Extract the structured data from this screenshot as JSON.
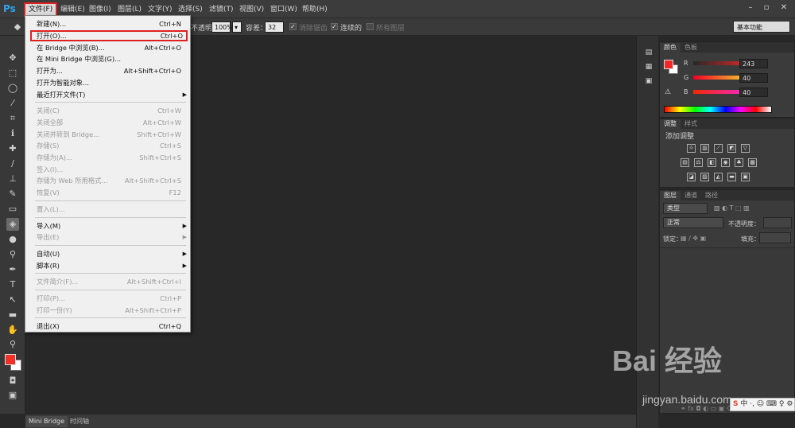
{
  "app": {
    "logo": "Ps"
  },
  "menubar": {
    "items": [
      "文件(F)",
      "编辑(E)",
      "图像(I)",
      "图层(L)",
      "文字(Y)",
      "选择(S)",
      "滤镜(T)",
      "视图(V)",
      "窗口(W)",
      "帮助(H)"
    ]
  },
  "options": {
    "opacity_label": "不透明度：",
    "opacity_value": "100%",
    "tolerance_label": "容差：",
    "tolerance_value": "32",
    "anti_alias_label": "消除锯齿",
    "contiguous_label": "连续的",
    "all_layers_label": "所有图层",
    "workspace": "基本功能"
  },
  "file_menu": {
    "items": [
      {
        "label": "新建(N)...",
        "shortcut": "Ctrl+N",
        "enabled": true
      },
      {
        "label": "打开(O)...",
        "shortcut": "Ctrl+O",
        "enabled": true,
        "highlighted": true
      },
      {
        "label": "在 Bridge 中浏览(B)...",
        "shortcut": "Alt+Ctrl+O",
        "enabled": true
      },
      {
        "label": "在 Mini Bridge 中浏览(G)...",
        "shortcut": "",
        "enabled": true
      },
      {
        "label": "打开为...",
        "shortcut": "Alt+Shift+Ctrl+O",
        "enabled": true
      },
      {
        "label": "打开为智能对象...",
        "shortcut": "",
        "enabled": true
      },
      {
        "label": "最近打开文件(T)",
        "shortcut": "",
        "enabled": true,
        "submenu": true
      },
      {
        "label": "关闭(C)",
        "shortcut": "Ctrl+W",
        "enabled": false
      },
      {
        "label": "关闭全部",
        "shortcut": "Alt+Ctrl+W",
        "enabled": false
      },
      {
        "label": "关闭并转到 Bridge...",
        "shortcut": "Shift+Ctrl+W",
        "enabled": false
      },
      {
        "label": "存储(S)",
        "shortcut": "Ctrl+S",
        "enabled": false
      },
      {
        "label": "存储为(A)...",
        "shortcut": "Shift+Ctrl+S",
        "enabled": false
      },
      {
        "label": "签入(I)...",
        "shortcut": "",
        "enabled": false
      },
      {
        "label": "存储为 Web 所用格式...",
        "shortcut": "Alt+Shift+Ctrl+S",
        "enabled": false
      },
      {
        "label": "恢复(V)",
        "shortcut": "F12",
        "enabled": false
      },
      {
        "label": "置入(L)...",
        "shortcut": "",
        "enabled": false
      },
      {
        "label": "导入(M)",
        "shortcut": "",
        "enabled": true,
        "submenu": true
      },
      {
        "label": "导出(E)",
        "shortcut": "",
        "enabled": false,
        "submenu": true
      },
      {
        "label": "自动(U)",
        "shortcut": "",
        "enabled": true,
        "submenu": true
      },
      {
        "label": "脚本(R)",
        "shortcut": "",
        "enabled": true,
        "submenu": true
      },
      {
        "label": "文件简介(F)...",
        "shortcut": "Alt+Shift+Ctrl+I",
        "enabled": false
      },
      {
        "label": "打印(P)...",
        "shortcut": "Ctrl+P",
        "enabled": false
      },
      {
        "label": "打印一份(Y)",
        "shortcut": "Alt+Shift+Ctrl+P",
        "enabled": false
      },
      {
        "label": "退出(X)",
        "shortcut": "Ctrl+Q",
        "enabled": true
      }
    ]
  },
  "color_panel": {
    "tabs": [
      "颜色",
      "色板"
    ],
    "r_label": "R",
    "r_value": "243",
    "g_label": "G",
    "g_value": "40",
    "b_label": "B",
    "b_value": "40",
    "foreground_color": "#f32828"
  },
  "adjust_panel": {
    "tabs": [
      "调整",
      "样式"
    ],
    "heading": "添加调整"
  },
  "layers_panel": {
    "tabs": [
      "图层",
      "通道",
      "路径"
    ],
    "filter_kind": "类型",
    "blend_mode": "正常",
    "opacity_label": "不透明度：",
    "lock_label": "锁定：",
    "fill_label": "填充："
  },
  "bottom": {
    "tabs": [
      "Mini Bridge",
      "时间轴"
    ]
  },
  "watermark": {
    "logo": "Bai  经验",
    "url": "jingyan.baidu.com"
  },
  "ime": {
    "text": "中 ·, ☺ ⌨ ♀ ⚙"
  }
}
